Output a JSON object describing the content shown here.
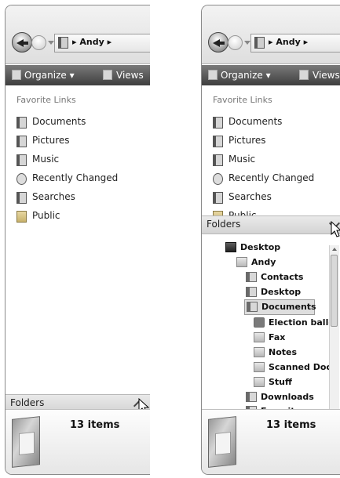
{
  "left_window": {
    "breadcrumb": "▸ Andy ▸",
    "toolbar": {
      "organize": "Organize ▾",
      "views": "Views"
    },
    "favorites_title": "Favorite Links",
    "links": [
      {
        "label": "Documents",
        "icon": "documents-icon"
      },
      {
        "label": "Pictures",
        "icon": "pictures-icon"
      },
      {
        "label": "Music",
        "icon": "music-icon"
      },
      {
        "label": "Recently Changed",
        "icon": "recently-changed-icon"
      },
      {
        "label": "Searches",
        "icon": "searches-icon"
      },
      {
        "label": "Public",
        "icon": "public-icon"
      }
    ],
    "folders_label": "Folders",
    "item_count": "13 items"
  },
  "right_window": {
    "breadcrumb": "▸ Andy ▸",
    "toolbar": {
      "organize": "Organize ▾",
      "views": "Views"
    },
    "favorites_title": "Favorite Links",
    "links": [
      {
        "label": "Documents",
        "icon": "documents-icon"
      },
      {
        "label": "Pictures",
        "icon": "pictures-icon"
      },
      {
        "label": "Music",
        "icon": "music-icon"
      },
      {
        "label": "Recently Changed",
        "icon": "recently-changed-icon"
      },
      {
        "label": "Searches",
        "icon": "searches-icon"
      },
      {
        "label": "Public",
        "icon": "public-icon"
      }
    ],
    "folders_label": "Folders",
    "tree": [
      {
        "label": "Desktop",
        "icon": "desktop-icon"
      },
      {
        "label": "Andy",
        "icon": "user-folder-icon"
      },
      {
        "label": "Contacts",
        "icon": "contacts-icon"
      },
      {
        "label": "Desktop",
        "icon": "desktop-folder-icon"
      },
      {
        "label": "Documents",
        "icon": "documents-folder-icon",
        "selected": true
      },
      {
        "label": "Election ballo",
        "icon": "briefcase-icon"
      },
      {
        "label": "Fax",
        "icon": "folder-icon"
      },
      {
        "label": "Notes",
        "icon": "folder-icon"
      },
      {
        "label": "Scanned Doc",
        "icon": "folder-icon"
      },
      {
        "label": "Stuff",
        "icon": "folder-icon"
      },
      {
        "label": "Downloads",
        "icon": "downloads-icon"
      },
      {
        "label": "Favorites",
        "icon": "favorites-icon"
      }
    ],
    "item_count": "13 items"
  }
}
